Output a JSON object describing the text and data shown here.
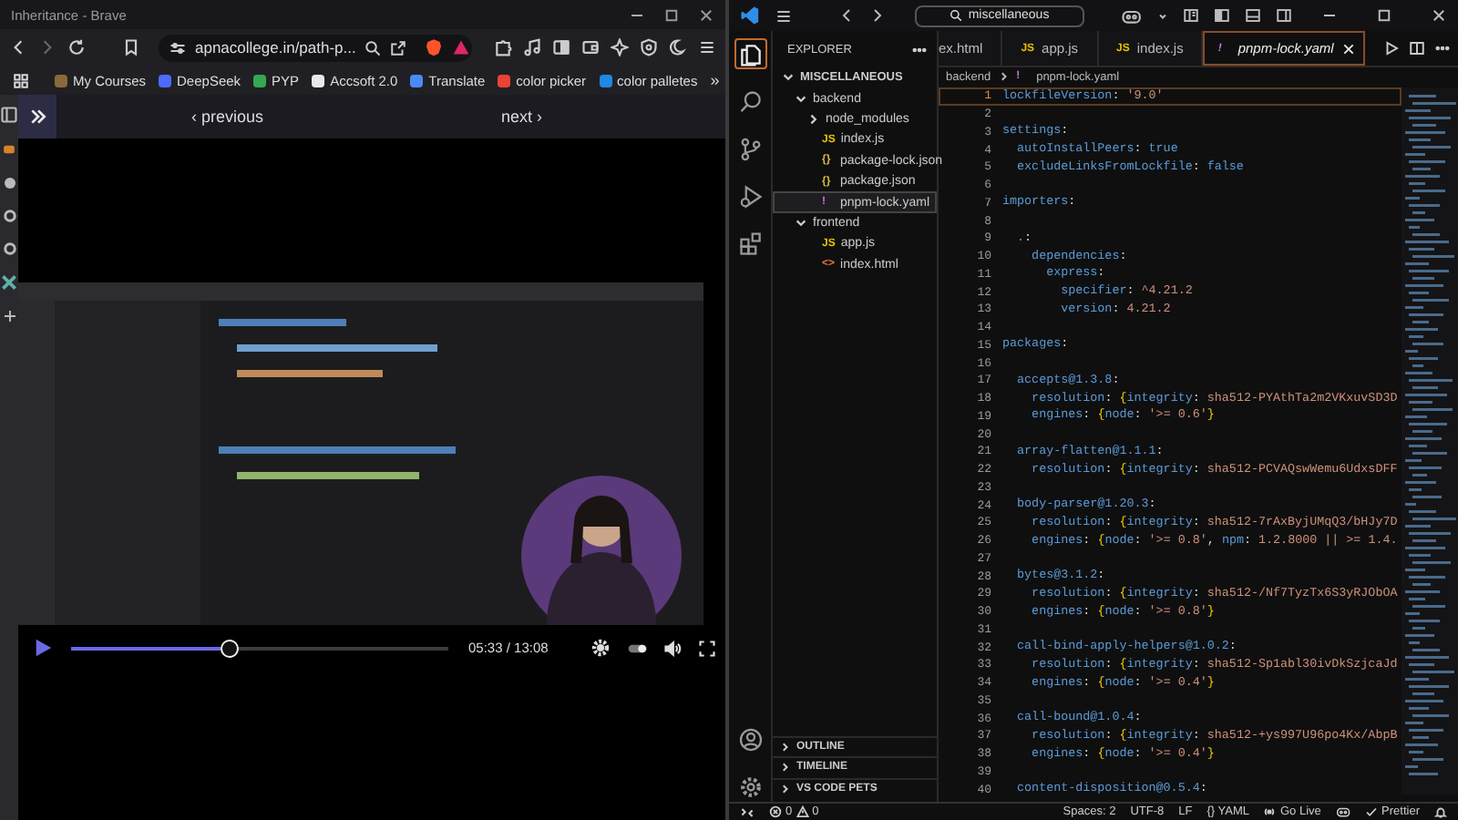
{
  "browser": {
    "title": "Inheritance - Brave",
    "address": "apnacollege.in/path-p...",
    "bookmarks": [
      {
        "label": "My Courses",
        "color": "#8a6a3a"
      },
      {
        "label": "DeepSeek",
        "color": "#4d6bfe"
      },
      {
        "label": "PYP",
        "color": "#34a853"
      },
      {
        "label": "Accsoft 2.0",
        "color": "#e8e8e8"
      },
      {
        "label": "Translate",
        "color": "#4a8af4"
      },
      {
        "label": "color picker",
        "color": "#ea4335"
      },
      {
        "label": "color palletes",
        "color": "#1e88e5"
      }
    ],
    "more_bookmarks": "»",
    "nav": {
      "previous": "‹ previous",
      "next": "next ›"
    },
    "player": {
      "kind": "picture",
      "time": "05:33 / 13:08",
      "level": 0.42
    }
  },
  "vscode": {
    "search": "miscellaneous",
    "explorer_title": "EXPLORER",
    "activity_bar": [
      {
        "kind": "explorer",
        "selected": true
      },
      {
        "kind": "search",
        "selected": false
      },
      {
        "kind": "source-control",
        "selected": false
      },
      {
        "kind": "run",
        "selected": false
      },
      {
        "kind": "extensions",
        "selected": false
      }
    ],
    "tree": [
      {
        "label": "MISCELLANEOUS",
        "kind": "root",
        "expanded": true,
        "selected": false,
        "children": [
          {
            "label": "backend",
            "expanded": true,
            "selected": false,
            "children": [
              {
                "label": "node_modules",
                "expanded": false,
                "selected": false
              },
              {
                "label": "index.js",
                "kind": "js",
                "icon": "JS",
                "selected": false
              },
              {
                "label": "package-lock.json",
                "kind": "json",
                "icon": "{}",
                "selected": false
              },
              {
                "label": "package.json",
                "kind": "json",
                "icon": "{}",
                "selected": false
              },
              {
                "label": "pnpm-lock.yaml",
                "kind": "yaml",
                "icon": "!",
                "selected": true
              }
            ]
          },
          {
            "label": "frontend",
            "expanded": true,
            "selected": false,
            "children": [
              {
                "label": "app.js",
                "kind": "js",
                "icon": "JS",
                "selected": false
              },
              {
                "label": "index.html",
                "kind": "html",
                "icon": "<>",
                "selected": false
              }
            ]
          }
        ]
      }
    ],
    "sections": [
      "OUTLINE",
      "TIMELINE",
      "VS CODE PETS"
    ],
    "tabs": [
      {
        "label": "ex.html",
        "selected": false
      },
      {
        "label": "app.js",
        "kind": "js",
        "icon": "JS",
        "selected": false
      },
      {
        "label": "index.js",
        "kind": "js",
        "icon": "JS",
        "selected": false
      },
      {
        "label": "pnpm-lock.yaml",
        "kind": "yaml",
        "icon": "!",
        "selected": true
      }
    ],
    "breadcrumb": [
      {
        "label": "backend"
      },
      {
        "label": "pnpm-lock.yaml",
        "icon": "!"
      }
    ],
    "lines": [
      {
        "n": "1",
        "current": true,
        "t": [
          {
            "kind": "key",
            "text": "lockfileVersion"
          },
          {
            "kind": "punct",
            "text": ": "
          },
          {
            "kind": "string",
            "text": "'9.0'"
          }
        ]
      },
      {
        "n": "2",
        "current": false
      },
      {
        "n": "3",
        "current": false,
        "t": [
          {
            "kind": "key",
            "text": "settings"
          },
          {
            "kind": "punct",
            "text": ":"
          }
        ]
      },
      {
        "n": "4",
        "current": false,
        "t": [
          {
            "kind": "key",
            "text": "  autoInstallPeers"
          },
          {
            "kind": "punct",
            "text": ": "
          },
          {
            "kind": "bool",
            "text": "true"
          }
        ]
      },
      {
        "n": "5",
        "current": false,
        "t": [
          {
            "kind": "key",
            "text": "  excludeLinksFromLockfile"
          },
          {
            "kind": "punct",
            "text": ": "
          },
          {
            "kind": "bool",
            "text": "false"
          }
        ]
      },
      {
        "n": "6",
        "current": false
      },
      {
        "n": "7",
        "current": false,
        "t": [
          {
            "kind": "key",
            "text": "importers"
          },
          {
            "kind": "punct",
            "text": ":"
          }
        ]
      },
      {
        "n": "8",
        "current": false
      },
      {
        "n": "9",
        "current": false,
        "t": [
          {
            "kind": "key",
            "text": "  ."
          },
          {
            "kind": "punct",
            "text": ":"
          }
        ]
      },
      {
        "n": "10",
        "current": false,
        "t": [
          {
            "kind": "key",
            "text": "    dependencies"
          },
          {
            "kind": "punct",
            "text": ":"
          }
        ]
      },
      {
        "n": "11",
        "current": false,
        "t": [
          {
            "kind": "key",
            "text": "      express"
          },
          {
            "kind": "punct",
            "text": ":"
          }
        ]
      },
      {
        "n": "12",
        "current": false,
        "t": [
          {
            "kind": "key",
            "text": "        specifier"
          },
          {
            "kind": "punct",
            "text": ": "
          },
          {
            "kind": "string",
            "text": "^4.21.2"
          }
        ]
      },
      {
        "n": "13",
        "current": false,
        "t": [
          {
            "kind": "key",
            "text": "        version"
          },
          {
            "kind": "punct",
            "text": ": "
          },
          {
            "kind": "string",
            "text": "4.21.2"
          }
        ]
      },
      {
        "n": "14",
        "current": false
      },
      {
        "n": "15",
        "current": false,
        "t": [
          {
            "kind": "key",
            "text": "packages"
          },
          {
            "kind": "punct",
            "text": ":"
          }
        ]
      },
      {
        "n": "16",
        "current": false
      },
      {
        "n": "17",
        "current": false,
        "t": [
          {
            "kind": "key",
            "text": "  accepts@1.3.8"
          },
          {
            "kind": "punct",
            "text": ":"
          }
        ]
      },
      {
        "n": "18",
        "current": false,
        "t": [
          {
            "kind": "key",
            "text": "    resolution"
          },
          {
            "kind": "punct",
            "text": ": "
          },
          {
            "kind": "brace",
            "text": "{"
          },
          {
            "kind": "key",
            "text": "integrity"
          },
          {
            "kind": "punct",
            "text": ": "
          },
          {
            "kind": "string",
            "text": "sha512-PYAthTa2m2VKxuvSD3D"
          }
        ]
      },
      {
        "n": "19",
        "current": false,
        "t": [
          {
            "kind": "key",
            "text": "    engines"
          },
          {
            "kind": "punct",
            "text": ": "
          },
          {
            "kind": "brace",
            "text": "{"
          },
          {
            "kind": "key",
            "text": "node"
          },
          {
            "kind": "punct",
            "text": ": "
          },
          {
            "kind": "string",
            "text": "'>= 0.6'"
          },
          {
            "kind": "brace",
            "text": "}"
          }
        ]
      },
      {
        "n": "20",
        "current": false
      },
      {
        "n": "21",
        "current": false,
        "t": [
          {
            "kind": "key",
            "text": "  array-flatten@1.1.1"
          },
          {
            "kind": "punct",
            "text": ":"
          }
        ]
      },
      {
        "n": "22",
        "current": false,
        "t": [
          {
            "kind": "key",
            "text": "    resolution"
          },
          {
            "kind": "punct",
            "text": ": "
          },
          {
            "kind": "brace",
            "text": "{"
          },
          {
            "kind": "key",
            "text": "integrity"
          },
          {
            "kind": "punct",
            "text": ": "
          },
          {
            "kind": "string",
            "text": "sha512-PCVAQswWemu6UdxsDFF"
          }
        ]
      },
      {
        "n": "23",
        "current": false
      },
      {
        "n": "24",
        "current": false,
        "t": [
          {
            "kind": "key",
            "text": "  body-parser@1.20.3"
          },
          {
            "kind": "punct",
            "text": ":"
          }
        ]
      },
      {
        "n": "25",
        "current": false,
        "t": [
          {
            "kind": "key",
            "text": "    resolution"
          },
          {
            "kind": "punct",
            "text": ": "
          },
          {
            "kind": "brace",
            "text": "{"
          },
          {
            "kind": "key",
            "text": "integrity"
          },
          {
            "kind": "punct",
            "text": ": "
          },
          {
            "kind": "string",
            "text": "sha512-7rAxByjUMqQ3/bHJy7D"
          }
        ]
      },
      {
        "n": "26",
        "current": false,
        "t": [
          {
            "kind": "key",
            "text": "    engines"
          },
          {
            "kind": "punct",
            "text": ": "
          },
          {
            "kind": "brace",
            "text": "{"
          },
          {
            "kind": "key",
            "text": "node"
          },
          {
            "kind": "punct",
            "text": ": "
          },
          {
            "kind": "string",
            "text": "'>= 0.8'"
          },
          {
            "kind": "punct",
            "text": ", "
          },
          {
            "kind": "key",
            "text": "npm"
          },
          {
            "kind": "punct",
            "text": ": "
          },
          {
            "kind": "string",
            "text": "1.2.8000 || >= 1.4."
          }
        ]
      },
      {
        "n": "27",
        "current": false
      },
      {
        "n": "28",
        "current": false,
        "t": [
          {
            "kind": "key",
            "text": "  bytes@3.1.2"
          },
          {
            "kind": "punct",
            "text": ":"
          }
        ]
      },
      {
        "n": "29",
        "current": false,
        "t": [
          {
            "kind": "key",
            "text": "    resolution"
          },
          {
            "kind": "punct",
            "text": ": "
          },
          {
            "kind": "brace",
            "text": "{"
          },
          {
            "kind": "key",
            "text": "integrity"
          },
          {
            "kind": "punct",
            "text": ": "
          },
          {
            "kind": "string",
            "text": "sha512-/Nf7TyzTx6S3yRJObOA"
          }
        ]
      },
      {
        "n": "30",
        "current": false,
        "t": [
          {
            "kind": "key",
            "text": "    engines"
          },
          {
            "kind": "punct",
            "text": ": "
          },
          {
            "kind": "brace",
            "text": "{"
          },
          {
            "kind": "key",
            "text": "node"
          },
          {
            "kind": "punct",
            "text": ": "
          },
          {
            "kind": "string",
            "text": "'>= 0.8'"
          },
          {
            "kind": "brace",
            "text": "}"
          }
        ]
      },
      {
        "n": "31",
        "current": false
      },
      {
        "n": "32",
        "current": false,
        "t": [
          {
            "kind": "key",
            "text": "  call-bind-apply-helpers@1.0.2"
          },
          {
            "kind": "punct",
            "text": ":"
          }
        ]
      },
      {
        "n": "33",
        "current": false,
        "t": [
          {
            "kind": "key",
            "text": "    resolution"
          },
          {
            "kind": "punct",
            "text": ": "
          },
          {
            "kind": "brace",
            "text": "{"
          },
          {
            "kind": "key",
            "text": "integrity"
          },
          {
            "kind": "punct",
            "text": ": "
          },
          {
            "kind": "string",
            "text": "sha512-Sp1abl30ivDkSzjcaJd"
          }
        ]
      },
      {
        "n": "34",
        "current": false,
        "t": [
          {
            "kind": "key",
            "text": "    engines"
          },
          {
            "kind": "punct",
            "text": ": "
          },
          {
            "kind": "brace",
            "text": "{"
          },
          {
            "kind": "key",
            "text": "node"
          },
          {
            "kind": "punct",
            "text": ": "
          },
          {
            "kind": "string",
            "text": "'>= 0.4'"
          },
          {
            "kind": "brace",
            "text": "}"
          }
        ]
      },
      {
        "n": "35",
        "current": false
      },
      {
        "n": "36",
        "current": false,
        "t": [
          {
            "kind": "key",
            "text": "  call-bound@1.0.4"
          },
          {
            "kind": "punct",
            "text": ":"
          }
        ]
      },
      {
        "n": "37",
        "current": false,
        "t": [
          {
            "kind": "key",
            "text": "    resolution"
          },
          {
            "kind": "punct",
            "text": ": "
          },
          {
            "kind": "brace",
            "text": "{"
          },
          {
            "kind": "key",
            "text": "integrity"
          },
          {
            "kind": "punct",
            "text": ": "
          },
          {
            "kind": "string",
            "text": "sha512-+ys997U96po4Kx/AbpB"
          }
        ]
      },
      {
        "n": "38",
        "current": false,
        "t": [
          {
            "kind": "key",
            "text": "    engines"
          },
          {
            "kind": "punct",
            "text": ": "
          },
          {
            "kind": "brace",
            "text": "{"
          },
          {
            "kind": "key",
            "text": "node"
          },
          {
            "kind": "punct",
            "text": ": "
          },
          {
            "kind": "string",
            "text": "'>= 0.4'"
          },
          {
            "kind": "brace",
            "text": "}"
          }
        ]
      },
      {
        "n": "39",
        "current": false
      },
      {
        "n": "40",
        "current": false,
        "t": [
          {
            "kind": "key",
            "text": "  content-disposition@0.5.4"
          },
          {
            "kind": "punct",
            "text": ":"
          }
        ]
      }
    ],
    "status": {
      "errors": "0",
      "warnings": "0",
      "items": [
        "Spaces: 2",
        "UTF-8",
        "LF",
        "{} YAML"
      ],
      "go_live": "Go Live",
      "prettier": "Prettier"
    }
  }
}
